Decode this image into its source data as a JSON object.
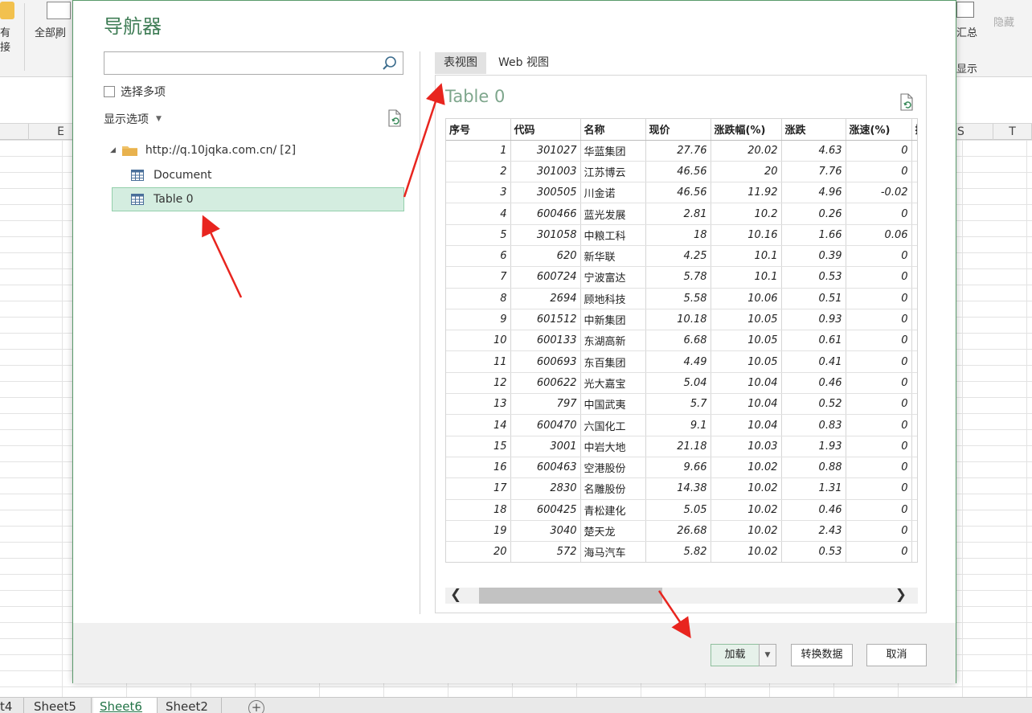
{
  "excel": {
    "ribbon": {
      "connections_line1": "有",
      "connections_line2": "接",
      "refresh_all": "全部刷",
      "subtotal": "汇总",
      "hide_detail": "隐藏",
      "show_detail": "显示",
      "outline": "显示"
    },
    "columns": [
      {
        "name": "E"
      },
      {
        "name": "S"
      },
      {
        "name": "T"
      }
    ],
    "sheet_tabs": [
      "t4",
      "Sheet5",
      "Sheet6",
      "Sheet2"
    ],
    "active_sheet": "Sheet6",
    "add_sheet": "+"
  },
  "navigator": {
    "title": "导航器",
    "search_placeholder": "",
    "select_multiple_label": "选择多项",
    "display_options_label": "显示选项",
    "tree": {
      "root_label": "http://q.10jqka.com.cn/",
      "root_count": "[2]",
      "items": [
        "Document",
        "Table 0"
      ],
      "selected": "Table 0"
    },
    "view_tabs": [
      "表视图",
      "Web 视图"
    ],
    "active_view_tab": "表视图",
    "preview_title": "Table 0",
    "buttons": {
      "load": "加载",
      "transform": "转换数据",
      "cancel": "取消"
    }
  },
  "table": {
    "columns": [
      "序号",
      "代码",
      "名称",
      "现价",
      "涨跌幅(%)",
      "涨跌",
      "涨速(%)",
      "换"
    ],
    "rows": [
      [
        "1",
        "301027",
        "华蓝集团",
        "27.76",
        "20.02",
        "4.63",
        "0"
      ],
      [
        "2",
        "301003",
        "江苏博云",
        "46.56",
        "20",
        "7.76",
        "0"
      ],
      [
        "3",
        "300505",
        "川金诺",
        "46.56",
        "11.92",
        "4.96",
        "-0.02"
      ],
      [
        "4",
        "600466",
        "蓝光发展",
        "2.81",
        "10.2",
        "0.26",
        "0"
      ],
      [
        "5",
        "301058",
        "中粮工科",
        "18",
        "10.16",
        "1.66",
        "0.06"
      ],
      [
        "6",
        "620",
        "新华联",
        "4.25",
        "10.1",
        "0.39",
        "0"
      ],
      [
        "7",
        "600724",
        "宁波富达",
        "5.78",
        "10.1",
        "0.53",
        "0"
      ],
      [
        "8",
        "2694",
        "顾地科技",
        "5.58",
        "10.06",
        "0.51",
        "0"
      ],
      [
        "9",
        "601512",
        "中新集团",
        "10.18",
        "10.05",
        "0.93",
        "0"
      ],
      [
        "10",
        "600133",
        "东湖高新",
        "6.68",
        "10.05",
        "0.61",
        "0"
      ],
      [
        "11",
        "600693",
        "东百集团",
        "4.49",
        "10.05",
        "0.41",
        "0"
      ],
      [
        "12",
        "600622",
        "光大嘉宝",
        "5.04",
        "10.04",
        "0.46",
        "0"
      ],
      [
        "13",
        "797",
        "中国武夷",
        "5.7",
        "10.04",
        "0.52",
        "0"
      ],
      [
        "14",
        "600470",
        "六国化工",
        "9.1",
        "10.04",
        "0.83",
        "0"
      ],
      [
        "15",
        "3001",
        "中岩大地",
        "21.18",
        "10.03",
        "1.93",
        "0"
      ],
      [
        "16",
        "600463",
        "空港股份",
        "9.66",
        "10.02",
        "0.88",
        "0"
      ],
      [
        "17",
        "2830",
        "名雕股份",
        "14.38",
        "10.02",
        "1.31",
        "0"
      ],
      [
        "18",
        "600425",
        "青松建化",
        "5.05",
        "10.02",
        "0.46",
        "0"
      ],
      [
        "19",
        "3040",
        "楚天龙",
        "26.68",
        "10.02",
        "2.43",
        "0"
      ],
      [
        "20",
        "572",
        "海马汽车",
        "5.82",
        "10.02",
        "0.53",
        "0"
      ]
    ]
  },
  "colors": {
    "accent_green": "#217346",
    "title_green": "#3f7d56",
    "selection_bg": "#d4ede0",
    "annotation_red": "#e8251f"
  },
  "icons": {
    "search": "search-icon",
    "refresh": "refresh-icon",
    "folder": "folder-icon",
    "table": "table-icon"
  }
}
